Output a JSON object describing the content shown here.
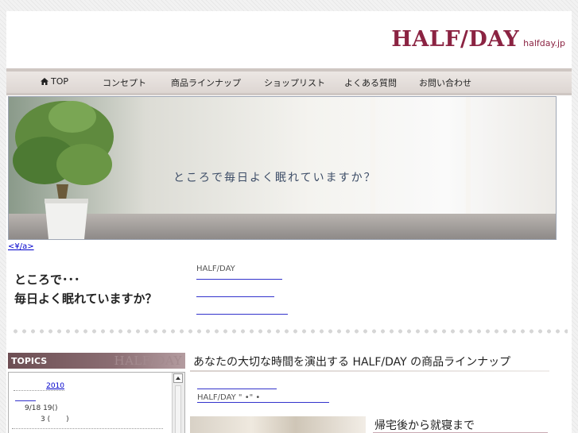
{
  "header": {
    "logo_main": "HALF/DAY",
    "logo_sub": "halfday.jp",
    "brand_color": "#8b2342"
  },
  "nav": {
    "items": [
      {
        "label": "TOP",
        "icon": "home-icon"
      },
      {
        "label": "コンセプト"
      },
      {
        "label": "商品ラインナップ"
      },
      {
        "label": "ショップリスト"
      },
      {
        "label": "よくある質問"
      },
      {
        "label": "お問い合わせ"
      }
    ]
  },
  "hero": {
    "caption": "ところで毎日よく眠れていますか？",
    "link_text": "<¥/a>"
  },
  "intro": {
    "line1": "ところで･･･",
    "line2": "毎日よく眠れていますか？",
    "links": [
      "HALF/DAY",
      "",
      ""
    ]
  },
  "topics": {
    "label": "TOPICS",
    "brand": "HALF/DAY",
    "year": "2010",
    "entry_date": "9/18  19(",
    "entry_date_close": ")",
    "entry_sub": "3 (",
    "entry_sub_close": ")"
  },
  "lineup": {
    "title": "あなたの大切な時間を演出する HALF/DAY の商品ラインナップ",
    "link_label": "HALF/DAY \"      •\"       •",
    "product_heading": "帰宅後から就寝まで"
  }
}
